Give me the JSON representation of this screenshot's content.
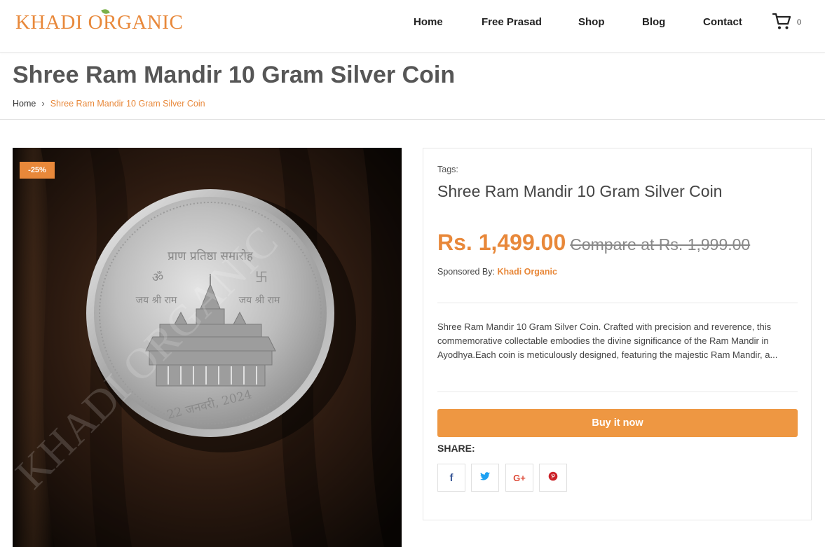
{
  "header": {
    "logo_text": "KHADI ORGANIC",
    "nav": [
      {
        "label": "Home"
      },
      {
        "label": "Free Prasad"
      },
      {
        "label": "Shop"
      },
      {
        "label": "Blog"
      },
      {
        "label": "Contact"
      }
    ],
    "cart_icon": "cart-icon",
    "cart_count": "0"
  },
  "page": {
    "title": "Shree Ram Mandir 10 Gram Silver Coin",
    "breadcrumb": {
      "home": "Home",
      "separator": "›",
      "current": "Shree Ram Mandir 10 Gram Silver Coin"
    }
  },
  "product_image": {
    "discount_badge": "-25%",
    "watermark": "KHADI ORGANIC",
    "coin": {
      "top_text": "प्राण प्रतिष्ठा समारोह",
      "left_text": "जय श्री राम",
      "right_text": "जय श्री राम",
      "date_text": "22 जनवरी, 2024",
      "om_symbol": "ॐ",
      "swastik_symbol": "卐"
    }
  },
  "product": {
    "tags_label": "Tags:",
    "name": "Shree Ram Mandir 10 Gram Silver Coin",
    "price": "Rs. 1,499.00",
    "compare_price": "Compare at Rs. 1,999.00",
    "sponsored_label": "Sponsored By:",
    "vendor": "Khadi Organic",
    "description": "Shree Ram Mandir 10 Gram Silver Coin. Crafted with precision and reverence, this commemorative collectable embodies the divine significance of the Ram Mandir in Ayodhya.Each coin is meticulously designed, featuring the majestic Ram Mandir, a...",
    "buy_label": "Buy it now",
    "share_label": "SHARE:",
    "share_buttons": [
      {
        "icon": "facebook-icon",
        "glyph": "f",
        "color": "#3b5998"
      },
      {
        "icon": "twitter-icon",
        "glyph": "t",
        "color": "#1da1f2"
      },
      {
        "icon": "google-plus-icon",
        "glyph": "G+",
        "color": "#dd4b39"
      },
      {
        "icon": "pinterest-icon",
        "glyph": "p",
        "color": "#cb2027"
      }
    ]
  },
  "colors": {
    "accent": "#e8883a",
    "button": "#ee9742",
    "leaf": "#7bb04a"
  }
}
